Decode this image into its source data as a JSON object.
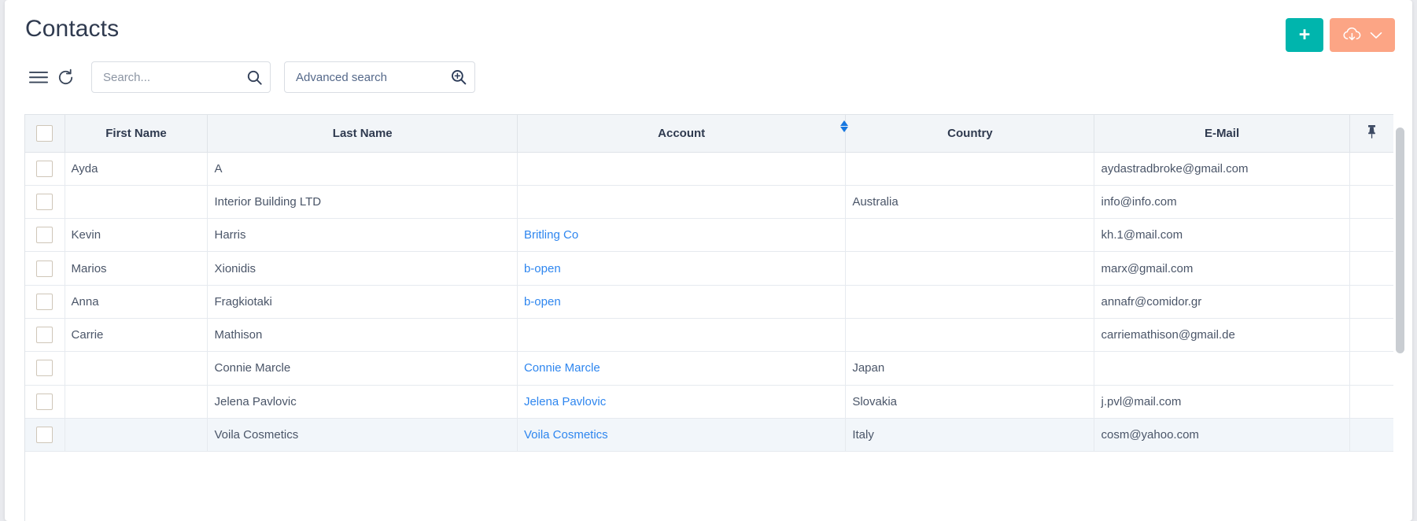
{
  "header": {
    "title": "Contacts",
    "add_button_label": "+",
    "add_button_color": "#00b5ad",
    "export_button_color": "#fca585",
    "export_icon": "cloud-download-icon",
    "export_chevron_icon": "chevron-down-icon"
  },
  "toolbar": {
    "menu_icon": "hamburger-menu-icon",
    "refresh_icon": "refresh-icon",
    "search": {
      "value": "",
      "placeholder": "Search...",
      "icon": "search-icon"
    },
    "advanced_search": {
      "value": "",
      "placeholder": "Advanced search",
      "icon": "advanced-search-icon"
    }
  },
  "table": {
    "select_all_checkbox": false,
    "pin_icon": "pin-icon",
    "sort_indicator": {
      "column": "Account",
      "state": "unsorted",
      "color": "#1677e0"
    },
    "columns": [
      {
        "key": "check",
        "label": ""
      },
      {
        "key": "first",
        "label": "First Name"
      },
      {
        "key": "last",
        "label": "Last Name"
      },
      {
        "key": "account",
        "label": "Account"
      },
      {
        "key": "country",
        "label": "Country"
      },
      {
        "key": "email",
        "label": "E-Mail"
      },
      {
        "key": "pin",
        "label": ""
      }
    ],
    "rows": [
      {
        "checked": false,
        "first": "Ayda",
        "last": "A",
        "account": "",
        "account_link": false,
        "country": "",
        "email": "aydastradbroke@gmail.com",
        "highlight": false
      },
      {
        "checked": false,
        "first": "",
        "last": "Interior Building LTD",
        "account": "",
        "account_link": false,
        "country": "Australia",
        "email": "info@info.com",
        "highlight": false
      },
      {
        "checked": false,
        "first": "Kevin",
        "last": "Harris",
        "account": "Britling Co",
        "account_link": true,
        "country": "",
        "email": "kh.1@mail.com",
        "highlight": false
      },
      {
        "checked": false,
        "first": "Marios",
        "last": "Xionidis",
        "account": "b-open",
        "account_link": true,
        "country": "",
        "email": "marx@gmail.com",
        "highlight": false
      },
      {
        "checked": false,
        "first": "Anna",
        "last": "Fragkiotaki",
        "account": "b-open",
        "account_link": true,
        "country": "",
        "email": "annafr@comidor.gr",
        "highlight": false
      },
      {
        "checked": false,
        "first": "Carrie",
        "last": "Mathison",
        "account": "",
        "account_link": false,
        "country": "",
        "email": "carriemathison@gmail.de",
        "highlight": false
      },
      {
        "checked": false,
        "first": "",
        "last": "Connie Marcle",
        "account": "Connie Marcle",
        "account_link": true,
        "country": "Japan",
        "email": "",
        "highlight": false
      },
      {
        "checked": false,
        "first": "",
        "last": "Jelena Pavlovic",
        "account": "Jelena Pavlovic",
        "account_link": true,
        "country": "Slovakia",
        "email": "j.pvl@mail.com",
        "highlight": false
      },
      {
        "checked": false,
        "first": "",
        "last": "Voila Cosmetics",
        "account": "Voila Cosmetics",
        "account_link": true,
        "country": "Italy",
        "email": "cosm@yahoo.com",
        "highlight": true
      }
    ]
  },
  "scrollbar": {
    "orientation": "vertical",
    "thumb_color": "#c9cdd2"
  }
}
